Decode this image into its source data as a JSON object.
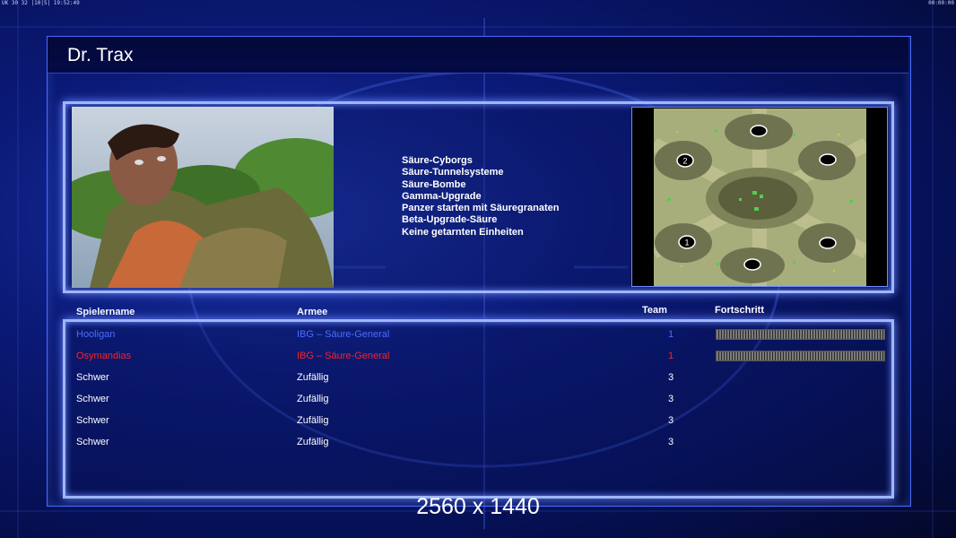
{
  "status_bar": {
    "left": "UK 30 32 |10|5| 19:52:49",
    "right": "00:00:00"
  },
  "title": "Dr. Trax",
  "features": [
    "Säure-Cyborgs",
    "Säure-Tunnelsysteme",
    "Säure-Bombe",
    "Gamma-Upgrade",
    "Panzer starten mit Säuregranaten",
    "Beta-Upgrade-Säure",
    "Keine getarnten Einheiten"
  ],
  "map": {
    "markers": [
      "1",
      "2"
    ]
  },
  "table": {
    "headers": {
      "player": "Spielername",
      "army": "Armee",
      "team": "Team",
      "progress": "Fortschritt"
    },
    "rows": [
      {
        "name": "Hooligan",
        "army": "IBG – Säure-General",
        "team": "1",
        "color": "#4b6cff",
        "progress": 1.0
      },
      {
        "name": "Osymandias",
        "army": "IBG – Säure-General",
        "team": "1",
        "color": "#ff2020",
        "progress": 1.0
      },
      {
        "name": "Schwer",
        "army": "Zufällig",
        "team": "3",
        "color": "#ffffff"
      },
      {
        "name": "Schwer",
        "army": "Zufällig",
        "team": "3",
        "color": "#ffffff"
      },
      {
        "name": "Schwer",
        "army": "Zufällig",
        "team": "3",
        "color": "#ffffff"
      },
      {
        "name": "Schwer",
        "army": "Zufällig",
        "team": "3",
        "color": "#ffffff"
      }
    ]
  },
  "resolution_overlay": "2560 x 1440"
}
